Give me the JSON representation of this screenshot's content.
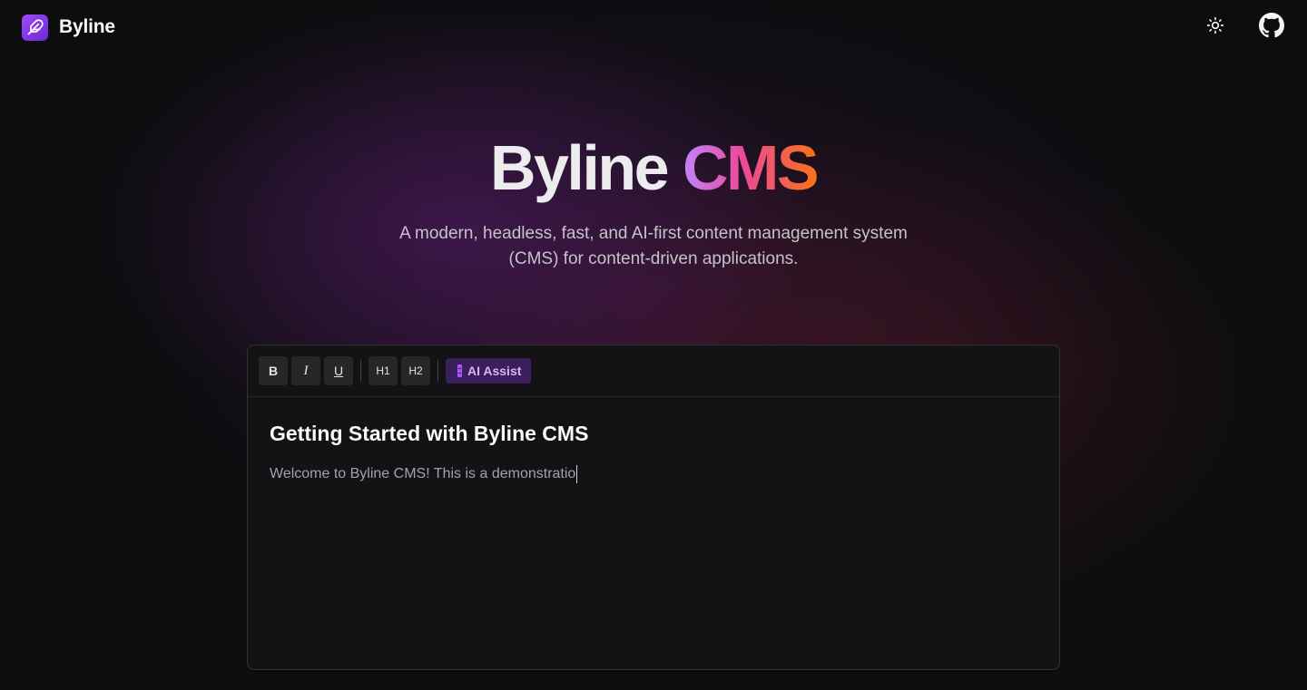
{
  "header": {
    "brand_name": "Byline",
    "logo_icon": "feather-icon",
    "theme_toggle_icon": "sun-icon",
    "repo_icon": "github-icon"
  },
  "hero": {
    "title_main": "Byline",
    "title_accent": "CMS",
    "subtitle": "A modern, headless, fast, and AI-first content management system (CMS) for content-driven applications.",
    "accent_gradient": [
      "#c084fc",
      "#ec4899",
      "#f97316"
    ]
  },
  "editor": {
    "toolbar": {
      "bold_label": "B",
      "italic_label": "I",
      "underline_label": "U",
      "h1_label": "H1",
      "h2_label": "H2",
      "ai_assist_label": "AI Assist"
    },
    "document": {
      "title": "Getting Started with Byline CMS",
      "body": "Welcome to Byline CMS! This is a demonstratio"
    }
  },
  "colors": {
    "background": "#0d0d10",
    "editor_bg": "#131315",
    "ai_button_bg": "#3b1f5c",
    "ai_button_text": "#d8b4fe",
    "brand_logo": "#7c3aed"
  }
}
